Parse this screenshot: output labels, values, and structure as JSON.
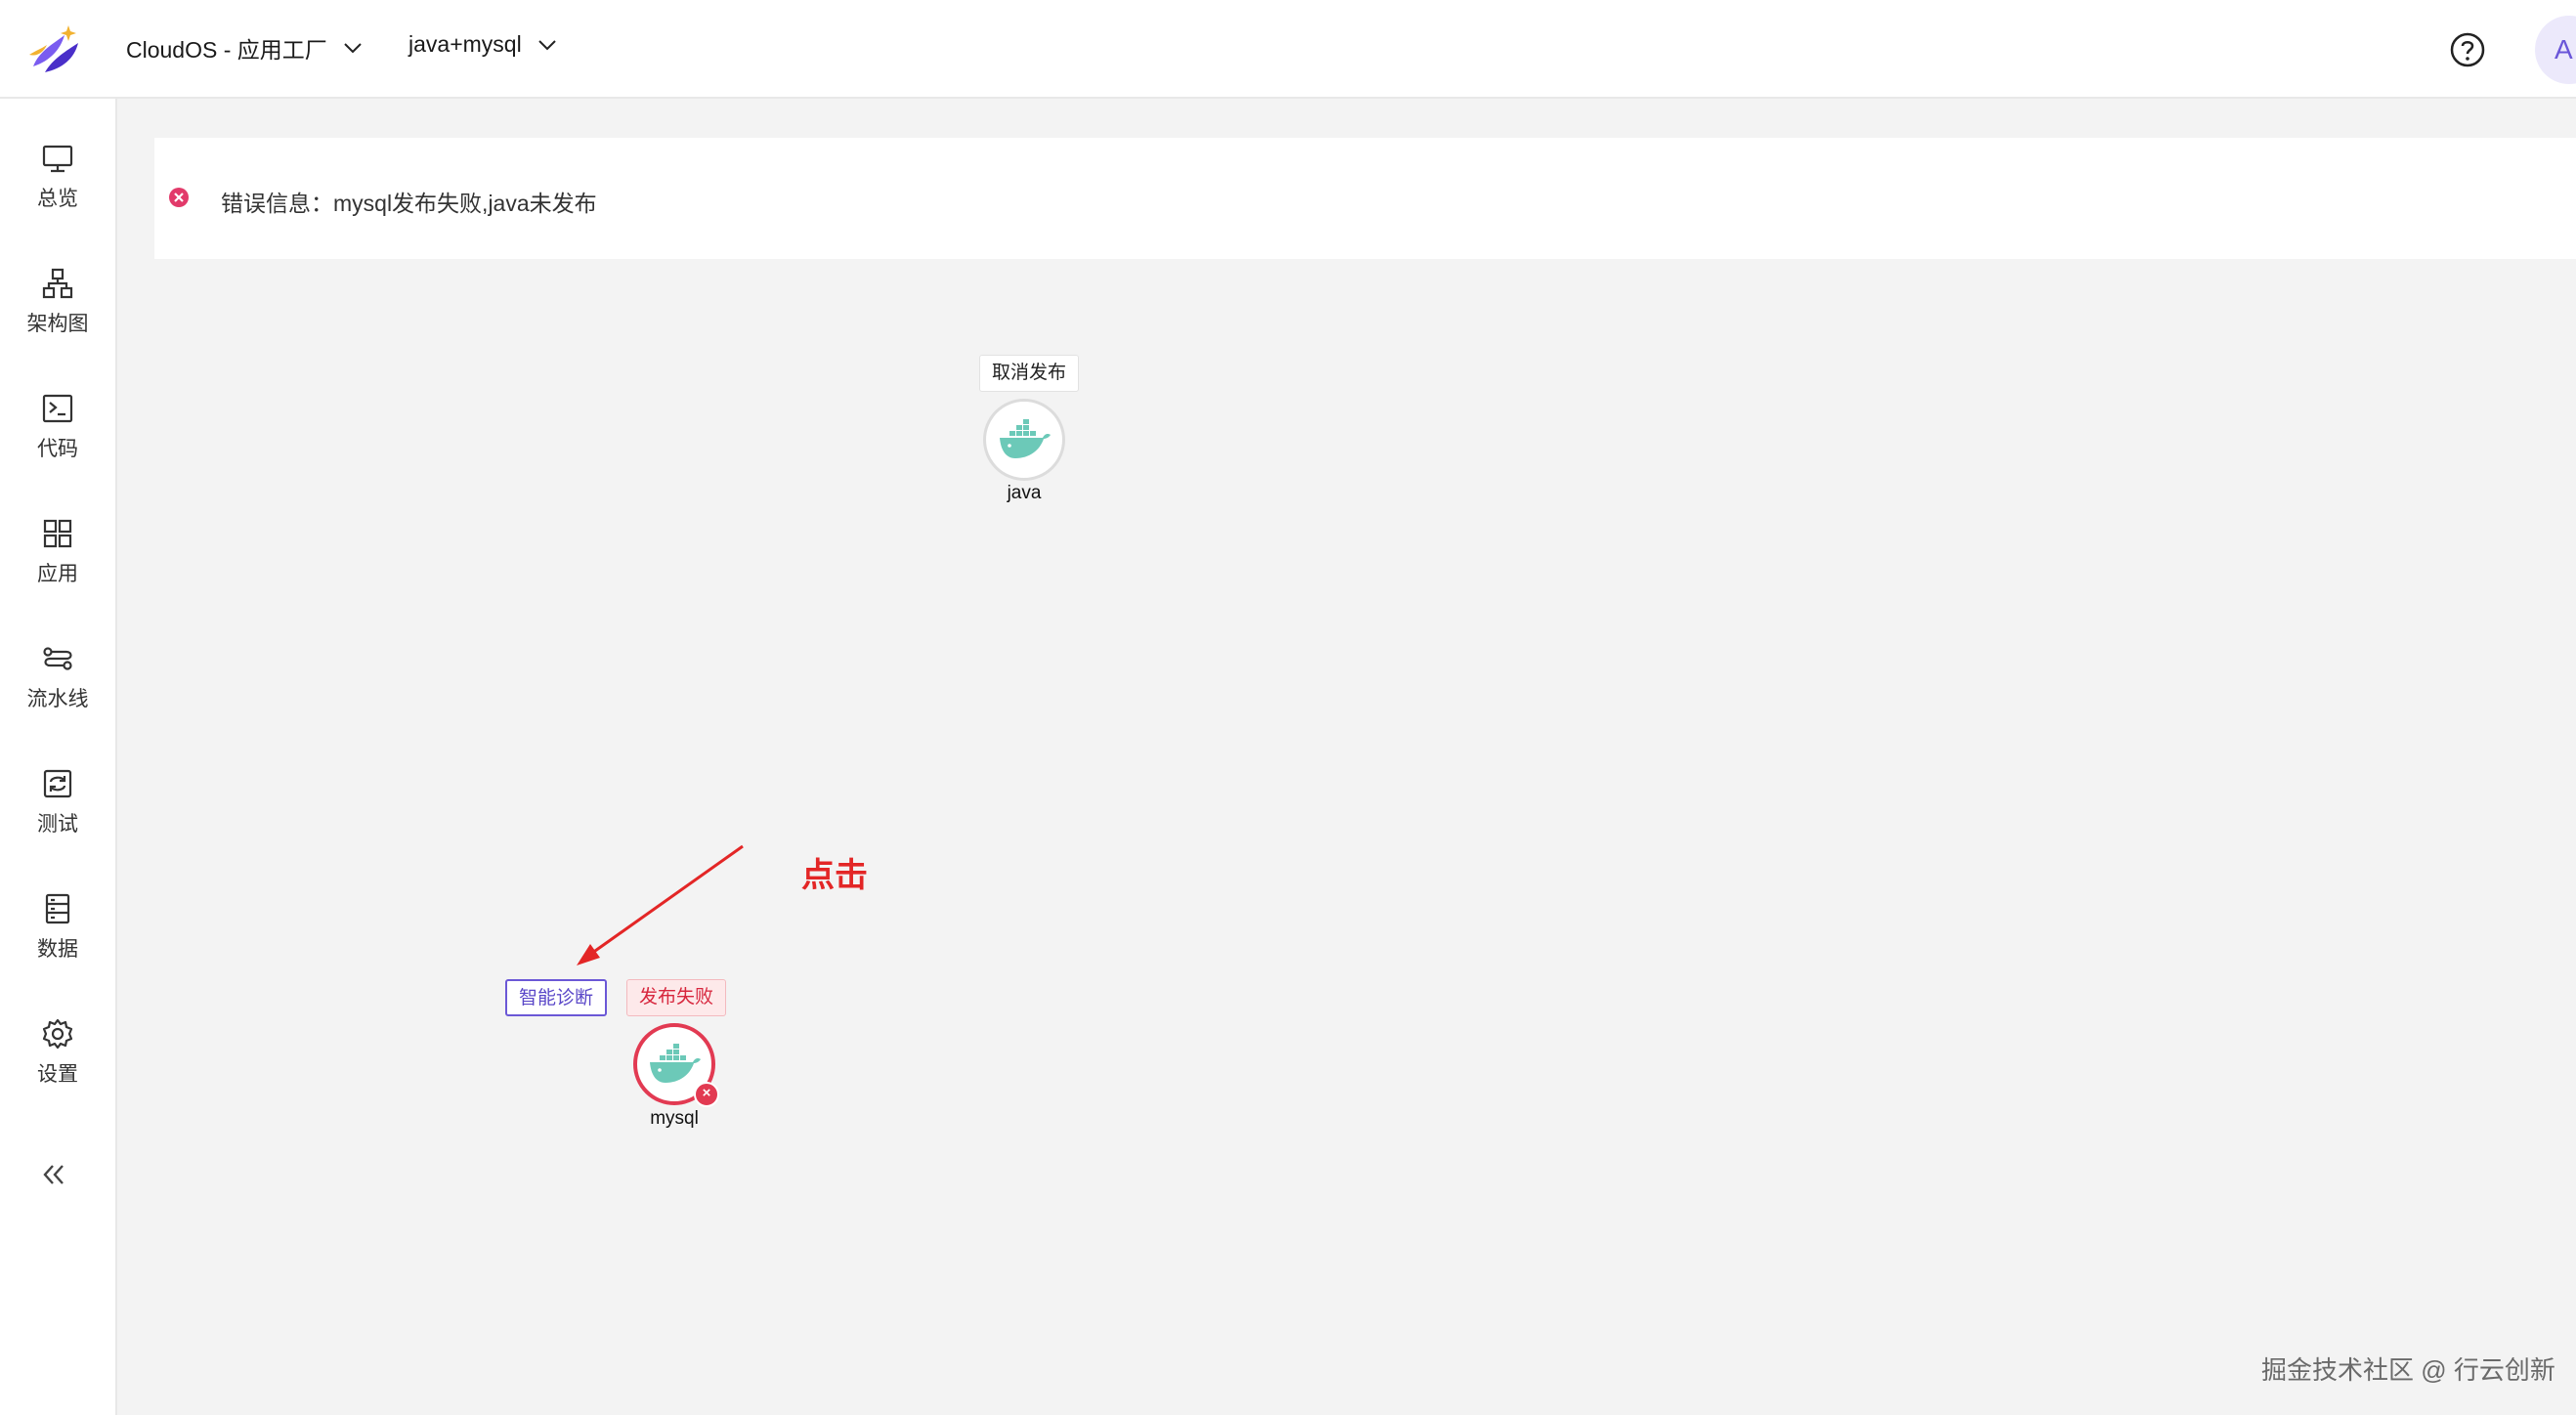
{
  "header": {
    "app_name": "CloudOS - 应用工厂",
    "project_name": "java+mysql",
    "avatar_initial": "A"
  },
  "sidebar": {
    "items": [
      {
        "label": "总览",
        "icon": "monitor-icon"
      },
      {
        "label": "架构图",
        "icon": "hierarchy-icon"
      },
      {
        "label": "代码",
        "icon": "terminal-icon"
      },
      {
        "label": "应用",
        "icon": "grid-icon"
      },
      {
        "label": "流水线",
        "icon": "pipeline-icon"
      },
      {
        "label": "测试",
        "icon": "refresh-icon"
      },
      {
        "label": "数据",
        "icon": "database-icon"
      },
      {
        "label": "设置",
        "icon": "gear-icon"
      }
    ]
  },
  "error_banner": {
    "message": "错误信息：mysql发布失败,java未发布"
  },
  "canvas": {
    "nodes": [
      {
        "name": "java",
        "tags": [
          "取消发布"
        ],
        "status": "unpublished"
      },
      {
        "name": "mysql",
        "tags": [
          "智能诊断",
          "发布失败"
        ],
        "status": "failed"
      }
    ],
    "annotation": "点击"
  },
  "watermark": "掘金技术社区 @ 行云创新",
  "colors": {
    "accent": "#6b58d6",
    "error": "#e23a52",
    "annotation": "#e32626"
  }
}
